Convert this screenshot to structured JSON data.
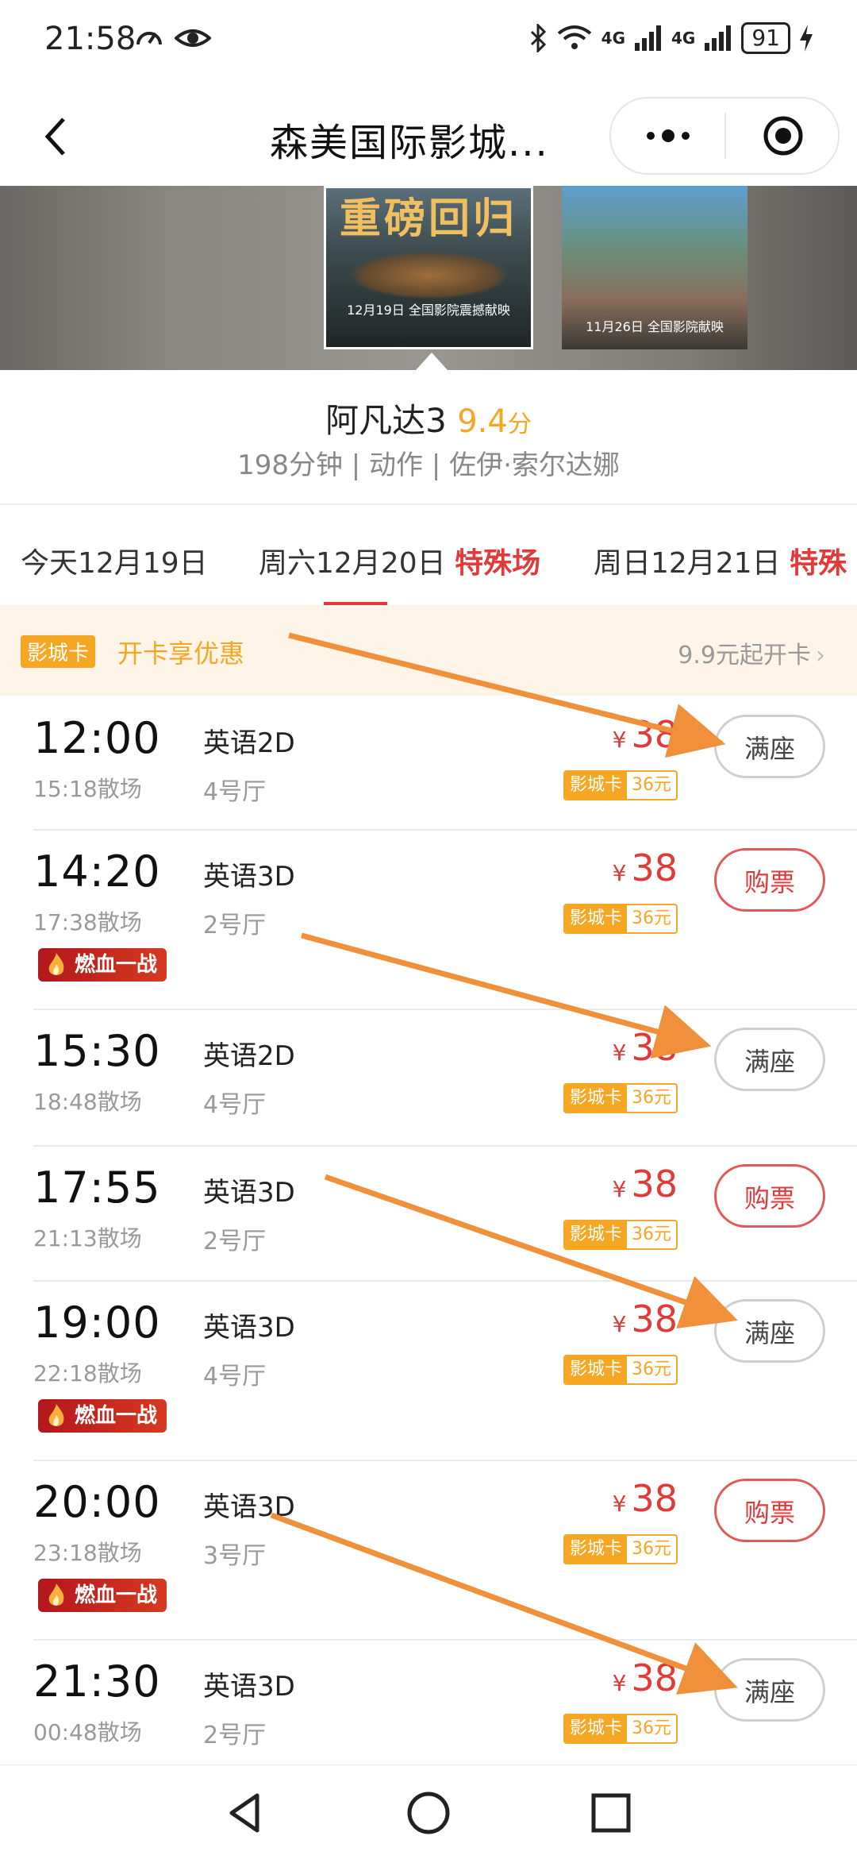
{
  "status_bar": {
    "time": "21:58",
    "network_a": "4G",
    "network_b": "4G",
    "battery": "91"
  },
  "nav": {
    "title": "森美国际影城..."
  },
  "banner": {
    "main_poster_head": "重磅回归",
    "main_poster_caption": "12月19日 全国影院震撼献映",
    "side_poster_caption": "11月26日 全国影院献映"
  },
  "movie": {
    "title": "阿凡达3",
    "score": "9.4",
    "score_unit": "分",
    "meta": "198分钟 | 动作 | 佐伊·索尔达娜"
  },
  "date_tabs": [
    {
      "label": "今天12月19日",
      "tag": ""
    },
    {
      "label": "周六12月20日",
      "tag": "特殊场"
    },
    {
      "label": "周日12月21日",
      "tag": "特殊"
    }
  ],
  "promo": {
    "badge": "影城卡",
    "text": "开卡享优惠",
    "right": "9.9元起开卡",
    "chevron": "›"
  },
  "colors": {
    "accent_red": "#e03a3a",
    "accent_orange": "#f5a623",
    "promo_bg": "#fff4e8",
    "arrow": "#f0903a"
  },
  "shows": [
    {
      "start": "12:00",
      "end": "15:18散场",
      "lang": "英语2D",
      "hall": "4号厅",
      "yen": "¥",
      "price": "38",
      "card_label": "影城卡",
      "card_price": "36元",
      "action": "满座",
      "tag": ""
    },
    {
      "start": "14:20",
      "end": "17:38散场",
      "lang": "英语3D",
      "hall": "2号厅",
      "yen": "¥",
      "price": "38",
      "card_label": "影城卡",
      "card_price": "36元",
      "action": "购票",
      "tag": "燃血一战"
    },
    {
      "start": "15:30",
      "end": "18:48散场",
      "lang": "英语2D",
      "hall": "4号厅",
      "yen": "¥",
      "price": "38",
      "card_label": "影城卡",
      "card_price": "36元",
      "action": "满座",
      "tag": ""
    },
    {
      "start": "17:55",
      "end": "21:13散场",
      "lang": "英语3D",
      "hall": "2号厅",
      "yen": "¥",
      "price": "38",
      "card_label": "影城卡",
      "card_price": "36元",
      "action": "购票",
      "tag": ""
    },
    {
      "start": "19:00",
      "end": "22:18散场",
      "lang": "英语3D",
      "hall": "4号厅",
      "yen": "¥",
      "price": "38",
      "card_label": "影城卡",
      "card_price": "36元",
      "action": "满座",
      "tag": "燃血一战"
    },
    {
      "start": "20:00",
      "end": "23:18散场",
      "lang": "英语3D",
      "hall": "3号厅",
      "yen": "¥",
      "price": "38",
      "card_label": "影城卡",
      "card_price": "36元",
      "action": "购票",
      "tag": "燃血一战"
    },
    {
      "start": "21:30",
      "end": "00:48散场",
      "lang": "英语3D",
      "hall": "2号厅",
      "yen": "¥",
      "price": "38",
      "card_label": "影城卡",
      "card_price": "36元",
      "action": "满座",
      "tag": ""
    }
  ]
}
